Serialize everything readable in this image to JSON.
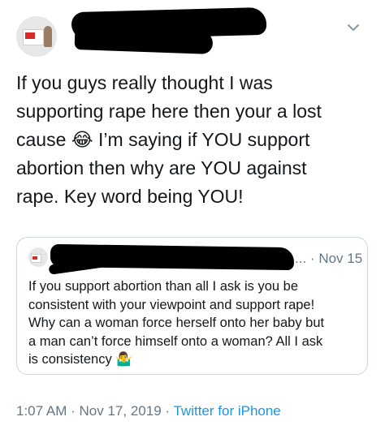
{
  "tweet": {
    "text_lines": "If you guys really thought I was\nsupporting rape here then your a lost\ncause 😂 I’m saying if YOU support\nabortion then why are YOU against\nrape. Key word being YOU!"
  },
  "quoted_tweet": {
    "ellipsis": "...",
    "separator": "·",
    "date": "Nov 15",
    "text_lines": "If you support abortion than all I ask is you be\nconsistent with your viewpoint and support rape!\nWhy can a woman force herself onto her baby but\na man can’t force himself onto a woman? All I ask",
    "last_line": "is consistency",
    "emoji": "🤷‍♂️"
  },
  "meta": {
    "time": "1:07 AM",
    "sep1": "·",
    "date": "Nov 17, 2019",
    "sep2": "·",
    "source": "Twitter for iPhone"
  },
  "colors": {
    "text": "#14171a",
    "secondary": "#657786",
    "link": "#1b95e0",
    "border": "#ccd6dd"
  },
  "icons": [
    "chevron-down-icon"
  ]
}
